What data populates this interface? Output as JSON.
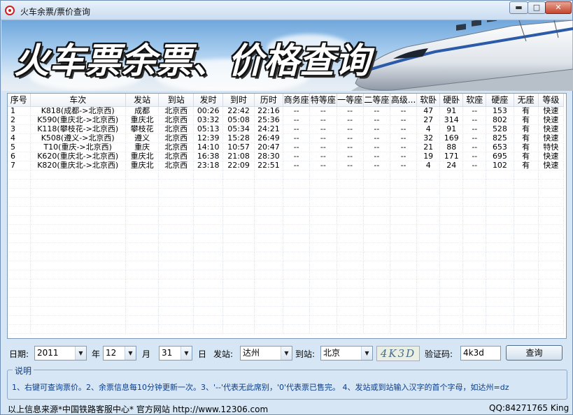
{
  "window": {
    "title": "火车余票/票价查询",
    "controls": {
      "minimize": "▬",
      "maximize": "□",
      "close": "✕"
    }
  },
  "banner": {
    "title": "火车票余票、价格查询"
  },
  "table": {
    "columns": [
      "序号",
      "车次",
      "发站",
      "到站",
      "发时",
      "到时",
      "历时",
      "商务座",
      "特等座",
      "一等座",
      "二等座",
      "高级...",
      "软卧",
      "硬卧",
      "软座",
      "硬座",
      "无座",
      "等级"
    ],
    "rows": [
      [
        "1",
        "K818(成都->北京西)",
        "成都",
        "北京西",
        "00:26",
        "22:42",
        "22:16",
        "--",
        "--",
        "--",
        "--",
        "--",
        "47",
        "91",
        "--",
        "153",
        "有",
        "快速"
      ],
      [
        "2",
        "K590(重庆北->北京西)",
        "重庆北",
        "北京西",
        "03:32",
        "05:08",
        "25:36",
        "--",
        "--",
        "--",
        "--",
        "--",
        "27",
        "314",
        "--",
        "802",
        "有",
        "快速"
      ],
      [
        "3",
        "K118(攀枝花->北京西)",
        "攀枝花",
        "北京西",
        "05:13",
        "05:34",
        "24:21",
        "--",
        "--",
        "--",
        "--",
        "--",
        "4",
        "91",
        "--",
        "528",
        "有",
        "快速"
      ],
      [
        "4",
        "K508(遵义->北京西)",
        "遵义",
        "北京西",
        "12:39",
        "15:28",
        "26:49",
        "--",
        "--",
        "--",
        "--",
        "--",
        "32",
        "169",
        "--",
        "825",
        "有",
        "快速"
      ],
      [
        "5",
        "T10(重庆->北京西)",
        "重庆",
        "北京西",
        "14:10",
        "10:57",
        "20:47",
        "--",
        "--",
        "--",
        "--",
        "--",
        "21",
        "88",
        "--",
        "653",
        "有",
        "特快"
      ],
      [
        "6",
        "K620(重庆北->北京西)",
        "重庆北",
        "北京西",
        "16:38",
        "21:08",
        "28:30",
        "--",
        "--",
        "--",
        "--",
        "--",
        "19",
        "171",
        "--",
        "695",
        "有",
        "快速"
      ],
      [
        "7",
        "K820(重庆北->北京西)",
        "重庆北",
        "北京西",
        "23:18",
        "22:09",
        "22:51",
        "--",
        "--",
        "--",
        "--",
        "--",
        "4",
        "24",
        "--",
        "102",
        "有",
        "快速"
      ]
    ]
  },
  "controls": {
    "date_label": "日期:",
    "year_value": "2011",
    "year_label": "年",
    "month_value": "12",
    "month_label": "月",
    "day_value": "31",
    "day_label": "日",
    "from_label": "发站:",
    "from_value": "达州",
    "to_label": "到站:",
    "to_value": "北京",
    "captcha_image_text": "4K3D",
    "captcha_label": "验证码:",
    "captcha_value": "4k3d",
    "query_button": "查询",
    "dropdown_arrow": "▼"
  },
  "notes": {
    "legend": "说明",
    "text": "1、右键可查询票价。2、余票信息每10分钟更新一次。3、'--'代表无此席别，'0'代表票已售完。 4、发站或到站输入汉字的首个字母，如达州=dz"
  },
  "status": {
    "left": "以上信息来源*中国铁路客服中心* 官方网站 http://www.12306.com",
    "right": "QQ:84271765 King"
  },
  "colors": {
    "banner_sky": "#8fbce6",
    "window_bg": "#d6e6f5",
    "notes_text": "#0a3c8a",
    "close_button": "#c4452d"
  },
  "icons": [
    "app-icon",
    "dropdown-arrow-icon",
    "train-image"
  ]
}
